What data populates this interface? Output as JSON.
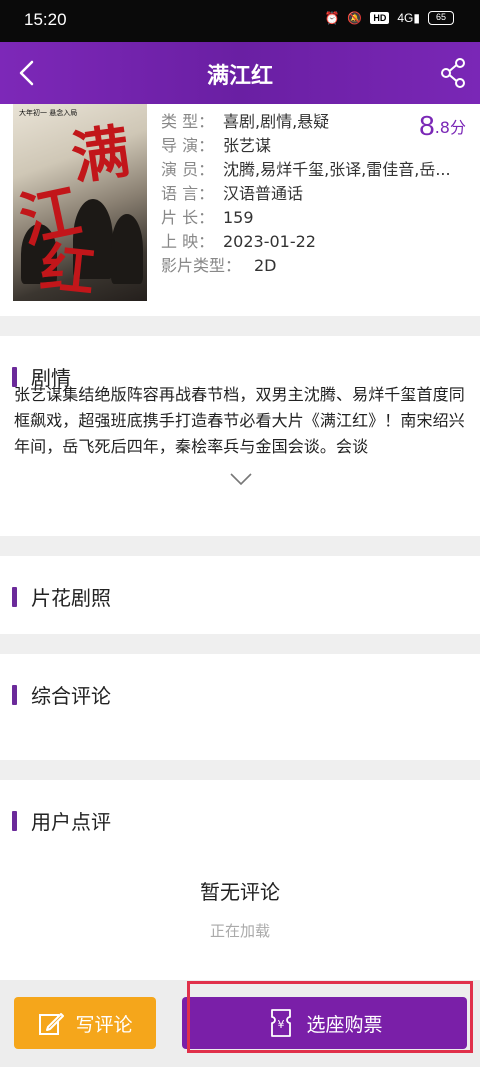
{
  "status_bar": {
    "time": "15:20",
    "network": "4G",
    "hd": "HD",
    "battery": "65"
  },
  "nav": {
    "title": "满江红"
  },
  "movie": {
    "score_int": "8",
    "score_dec": ".8分",
    "rows": [
      {
        "label": "类  型：",
        "value": "喜剧,剧情,悬疑"
      },
      {
        "label": "导  演：",
        "value": "张艺谋"
      },
      {
        "label": "演  员：",
        "value": "沈腾,易烊千玺,张译,雷佳音,岳..."
      },
      {
        "label": "语  言：",
        "value": "汉语普通话"
      },
      {
        "label": "片  长：",
        "value": "159"
      },
      {
        "label": "上  映：",
        "value": "2023-01-22"
      },
      {
        "label": "影片类型：",
        "value": "2D"
      }
    ],
    "poster": {
      "chars": [
        "满",
        "江",
        "红"
      ],
      "tag": "大年初一 悬念入局"
    }
  },
  "synopsis": {
    "title": "剧情",
    "text": "张艺谋集结绝版阵容再战春节档，双男主沈腾、易烊千玺首度同框飙戏，超强班底携手打造春节必看大片《满江红》！南宋绍兴年间，岳飞死后四年，秦桧率兵与金国会谈。会谈"
  },
  "sections": {
    "stills": "片花剧照",
    "reviews": "综合评论",
    "user_reviews": "用户点评",
    "no_review": "暂无评论",
    "loading": "正在加载"
  },
  "actions": {
    "write_comment": "写评论",
    "buy_ticket": "选座购票"
  },
  "colors": {
    "accent": "#7a27b6",
    "comment_btn": "#f5a61b",
    "highlight": "#e0304a"
  }
}
